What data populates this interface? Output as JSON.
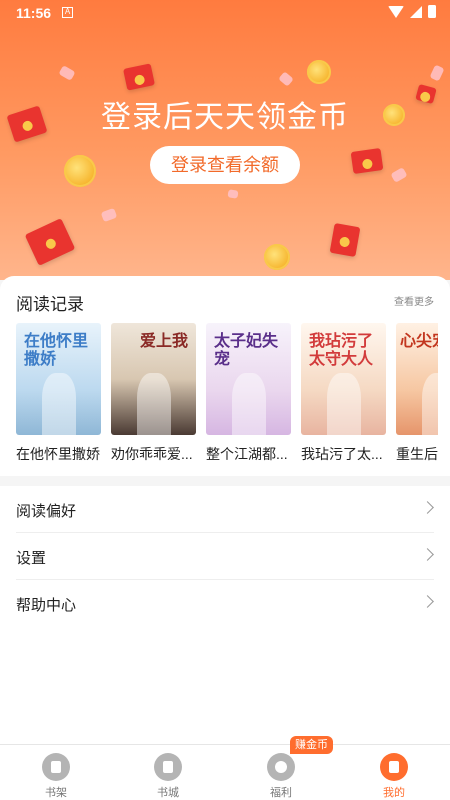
{
  "status_bar": {
    "time": "11:56",
    "notification": "A"
  },
  "hero": {
    "title": "登录后天天领金币",
    "button_label": "登录查看余额"
  },
  "history": {
    "title": "阅读记录",
    "more_label": "查看更多",
    "books": [
      {
        "title": "在他怀里撒娇",
        "cover_text": "在他怀里撒娇"
      },
      {
        "title": "劝你乖乖爱...",
        "cover_text": "爱上我"
      },
      {
        "title": "整个江湖都...",
        "cover_text": "太子妃失宠"
      },
      {
        "title": "我玷污了太...",
        "cover_text": "我玷污了太守大人"
      },
      {
        "title": "重生后",
        "cover_text": "心尖宠"
      }
    ]
  },
  "menu": {
    "items": [
      {
        "label": "阅读偏好"
      },
      {
        "label": "设置"
      },
      {
        "label": "帮助中心"
      }
    ]
  },
  "tabbar": {
    "badge": "赚金币",
    "tabs": [
      {
        "label": "书架"
      },
      {
        "label": "书城"
      },
      {
        "label": "福利"
      },
      {
        "label": "我的"
      }
    ]
  },
  "colors": {
    "accent": "#ff6d2e",
    "hero_top": "#ff7b3f",
    "hero_bottom": "#ffb58c"
  },
  "icons": [
    "wifi-icon",
    "signal-icon",
    "battery-icon",
    "chevron-right-icon",
    "bookshelf-icon",
    "bookstore-icon",
    "coin-icon",
    "profile-icon"
  ]
}
